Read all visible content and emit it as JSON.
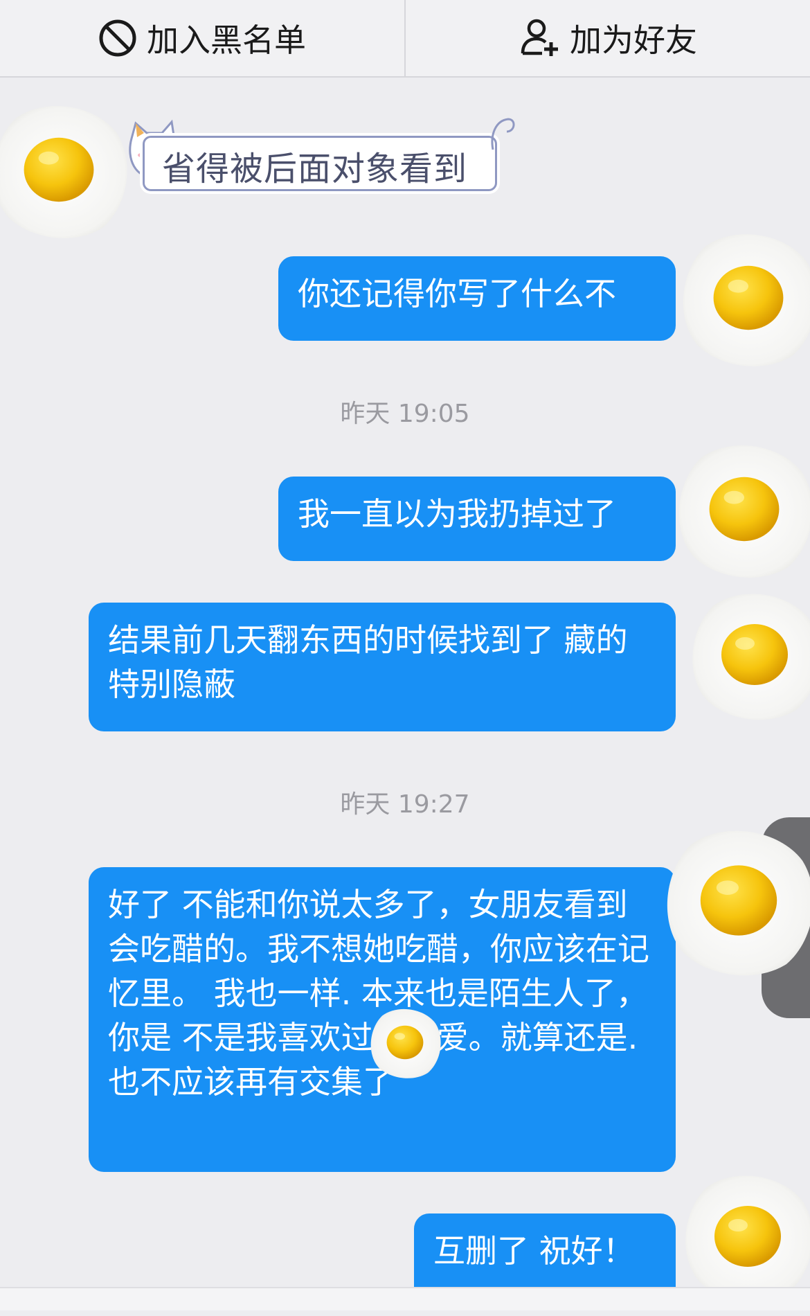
{
  "topbar": {
    "block_label": "加入黑名单",
    "add_friend_label": "加为好友"
  },
  "sticker": {
    "text": "省得被后面对象看到"
  },
  "messages": [
    {
      "text": "你还记得你写了什么不"
    },
    {
      "text": "我一直以为我扔掉过了"
    },
    {
      "text": "结果前几天翻东西的时候找到了 藏的特别隐蔽"
    },
    {
      "text": "好了 不能和你说太多了，女朋友看到会吃醋的。我不想她吃醋，你应该在记忆里。 我也一样. 本来也是陌生人了， 你是  不是我喜欢过的小爱。就算还是.也不应该再有交集了"
    },
    {
      "text": "互删了  祝好！"
    }
  ],
  "timestamps": {
    "first": "昨天 19:05",
    "second": "昨天 19:27"
  },
  "colors": {
    "bubble": "#1890f5",
    "background": "#ededf0"
  },
  "icons": {
    "block": "ban-icon",
    "add_friend": "add-user-icon",
    "decoration": "fried-egg-icon"
  }
}
